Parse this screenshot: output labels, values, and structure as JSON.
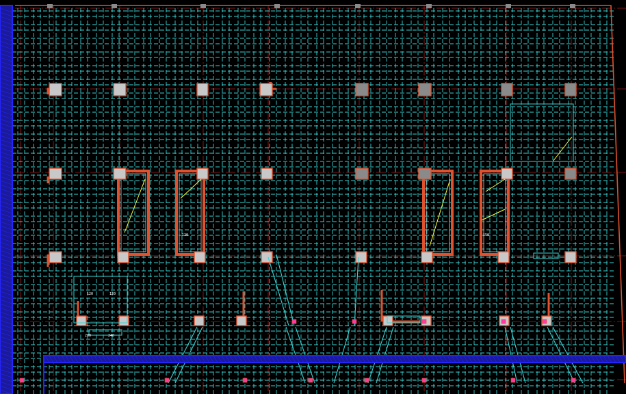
{
  "drawing": {
    "background": "#000000",
    "colors": {
      "grid_dash": "#39d3d3",
      "axis_red": "#b01818",
      "wall_outline": "#e0522e",
      "column_fill": "#c8c8c8",
      "column_dark_fill": "#8a8a8a",
      "boundary_blue": "#2424ff",
      "boundary_hatch": "#1a1a9a",
      "annotation_yellow": "#ffff40",
      "annotation_white": "#ffffff",
      "node_magenta": "#ff3aa0"
    },
    "dimension_labels": {
      "d1": "200",
      "d2": "240",
      "d3": "120",
      "d4": "120",
      "d5": "120",
      "d6": "150"
    },
    "icons": [
      "column-symbol",
      "cad-boundary-hatch",
      "grid-axis-line"
    ]
  }
}
